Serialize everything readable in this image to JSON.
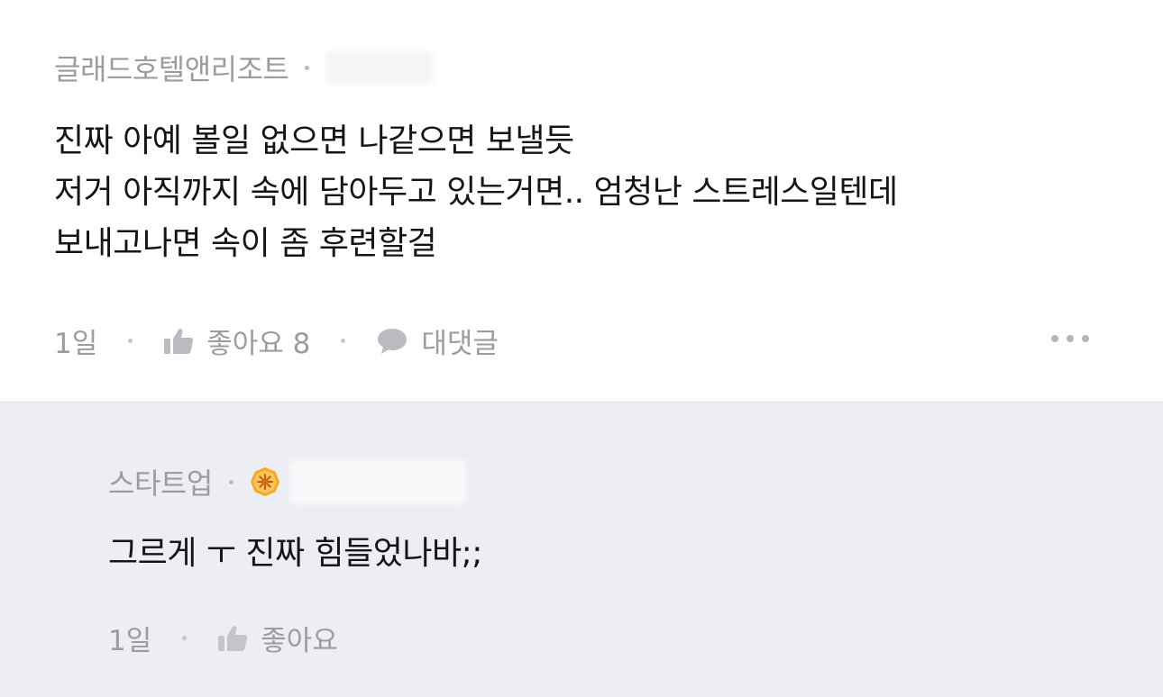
{
  "comment": {
    "author": "글래드호텔앤리조트",
    "body_lines": [
      "진짜 아예 볼일 없으면 나같으면 보낼듯",
      "저거 아직까지 속에 담아두고 있는거면.. 엄청난 스트레스일텐데",
      "보내고나면 속이 좀 후련할걸"
    ],
    "time": "1일",
    "like_label": "좋아요 8",
    "reply_label": "대댓글",
    "icons": {
      "like": "thumbs-up-icon",
      "reply": "speech-bubble-icon",
      "more": "more-dots-icon"
    }
  },
  "reply": {
    "author": "스타트업",
    "badge_icon": "gold-sun-badge-icon",
    "body": "그르게 ㅜ 진짜 힘들었나바;;",
    "time": "1일",
    "like_label": "좋아요",
    "icons": {
      "like": "thumbs-up-icon"
    }
  },
  "colors": {
    "reply_background": "#eceef3",
    "meta_text": "#9a9ca1",
    "badge_gold": "#f2a91e"
  }
}
